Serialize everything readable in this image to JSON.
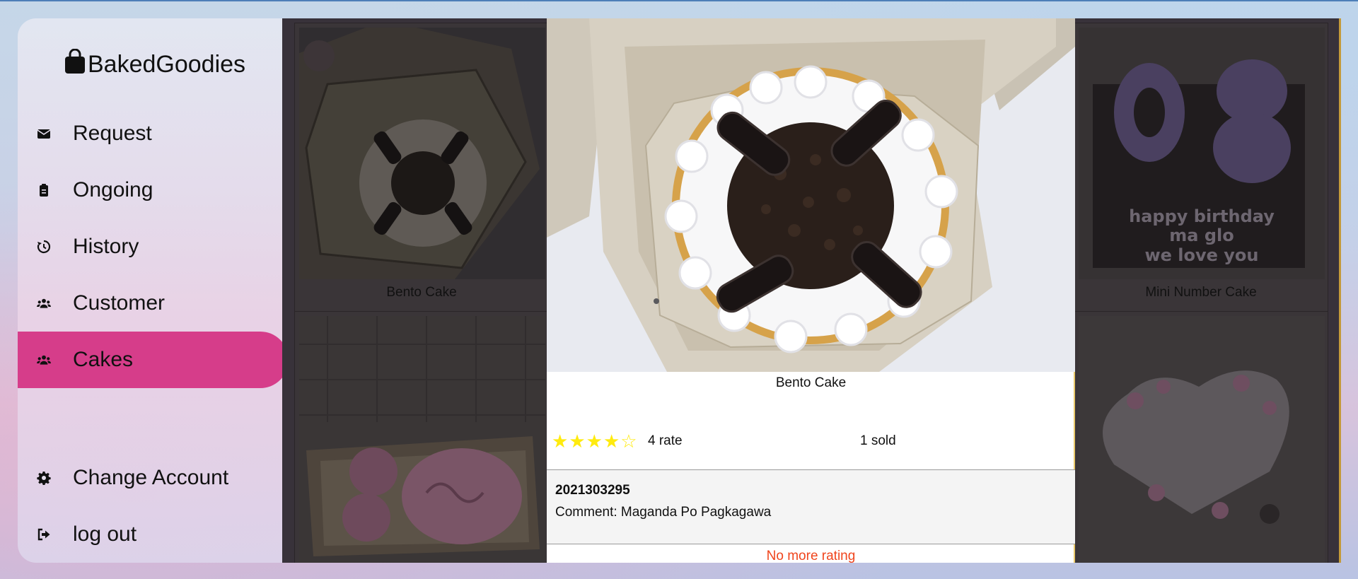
{
  "app": {
    "brand": "BakedGoodies"
  },
  "sidebar": {
    "items": [
      {
        "label": "Request",
        "icon": "envelope-icon"
      },
      {
        "label": "Ongoing",
        "icon": "clipboard-icon"
      },
      {
        "label": "History",
        "icon": "history-icon"
      },
      {
        "label": "Customer",
        "icon": "users-icon"
      },
      {
        "label": "Cakes",
        "icon": "users-icon",
        "active": true
      }
    ],
    "bottom_items": [
      {
        "label": "Change Account",
        "icon": "gear-icon"
      },
      {
        "label": "log out",
        "icon": "logout-icon"
      }
    ],
    "active_color": "#d63d8a"
  },
  "grid": {
    "cards": [
      {
        "caption": "Bento Cake"
      },
      {
        "caption": "Mini Number Cake"
      }
    ]
  },
  "modal": {
    "title": "Bento Cake",
    "rating_value": 4,
    "rating_max": 5,
    "rate_label": "4 rate",
    "sold_label": "1 sold",
    "review": {
      "id": "2021303295",
      "comment": "Comment: Maganda Po Pagkagawa"
    },
    "no_more": "No more rating"
  },
  "colors": {
    "star": "#ffeb0e",
    "no_more": "#f0451d"
  }
}
